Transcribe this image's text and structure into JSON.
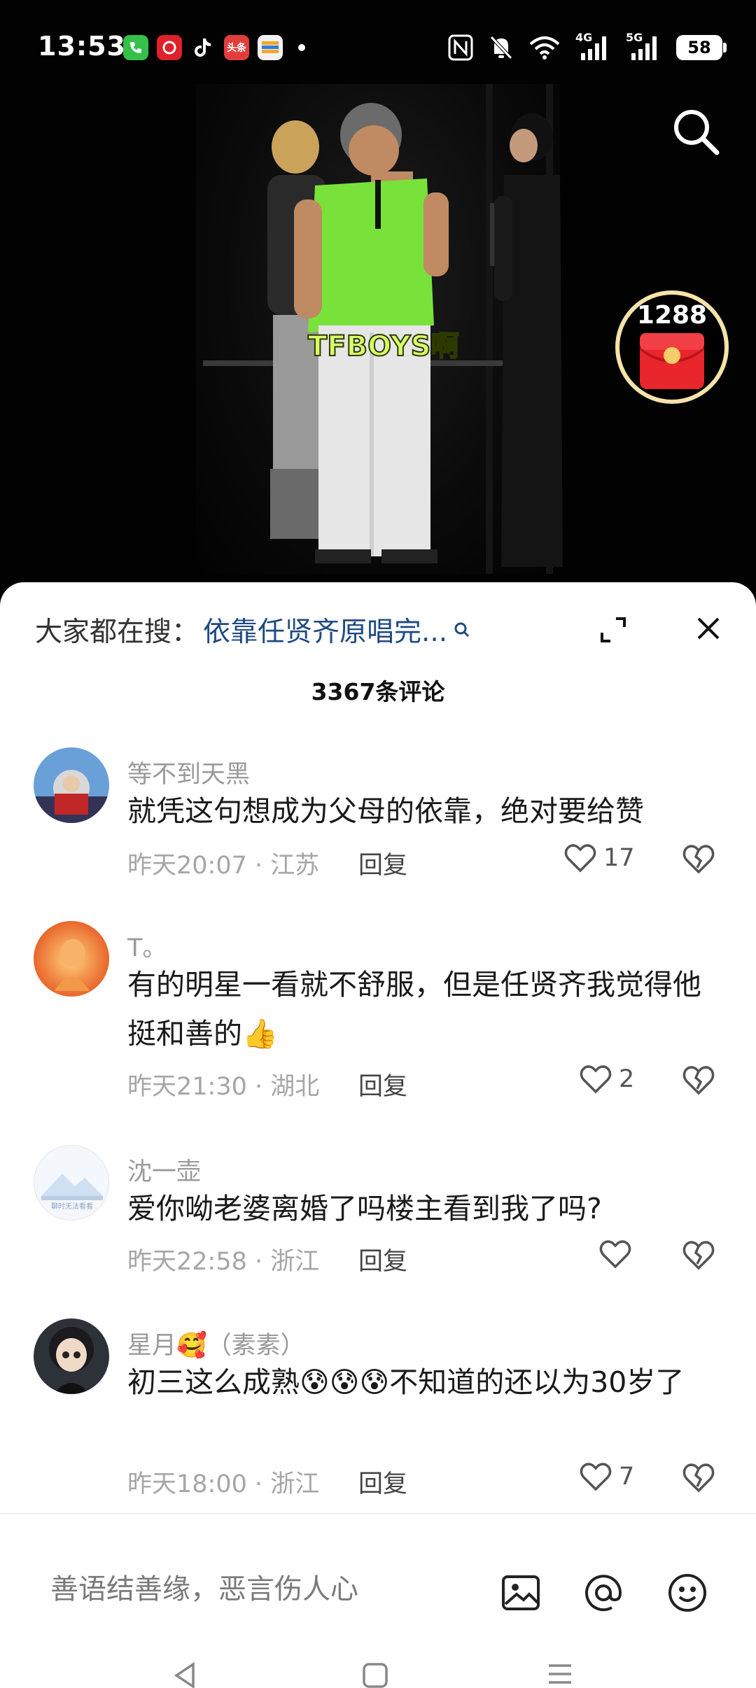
{
  "status": {
    "time": "13:53",
    "app_icons": [
      "phone-app",
      "taobao-app",
      "tiktok-app",
      "toutiao-app",
      "wallet-app"
    ],
    "toutiao_label": "头条",
    "network_4g": "4G",
    "network_5g": "5G",
    "battery": "58"
  },
  "video": {
    "caption": "TFBOYS啊",
    "redpack_count": "1288"
  },
  "sheet": {
    "trend_label": "大家都在搜：",
    "trend_query": "依靠任贤齐原唱完...",
    "comment_count": "3367条评论"
  },
  "comments": [
    {
      "user": "等不到天黑",
      "text": "就凭这句想成为父母的依靠，绝对要给赞",
      "time_loc": "昨天20:07 · 江苏",
      "reply": "回复",
      "likes": "17"
    },
    {
      "user": "T。",
      "text": "有的明星一看就不舒服，但是任贤齐我觉得他挺和善的👍",
      "time_loc": "昨天21:30 · 湖北",
      "reply": "回复",
      "likes": "2"
    },
    {
      "user": "沈一壶",
      "text": "爱你呦老婆离婚了吗楼主看到我了吗?",
      "avatar_text": "聊时无法看看",
      "time_loc": "昨天22:58 · 浙江",
      "reply": "回复",
      "likes": ""
    },
    {
      "user": "星月🥰（素素）",
      "text": "初三这么成熟😰😰😰不知道的还以为30岁了",
      "time_loc": "昨天18:00 · 浙江",
      "reply": "回复",
      "likes": "7"
    }
  ],
  "composer": {
    "placeholder": "善语结善缘，恶言伤人心"
  },
  "colors": {
    "accent_query": "#1f4a82",
    "caption": "#d8ff6a",
    "redpack": "#e8262b"
  }
}
